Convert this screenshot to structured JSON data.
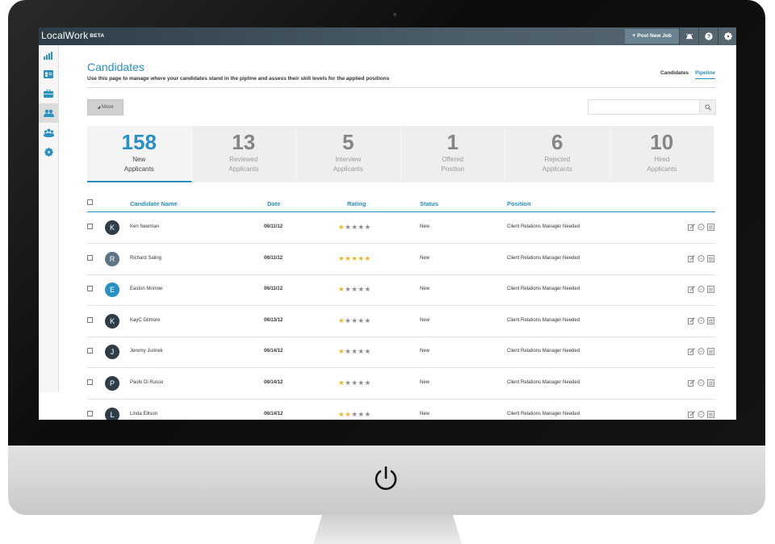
{
  "app": {
    "logo_text": "LocalWork",
    "logo_badge": "BETA"
  },
  "topbar": {
    "post_job_label": "Post New Job",
    "post_job_icon": "plus-icon",
    "icons": [
      "alarm-icon",
      "help-icon",
      "gear-icon"
    ]
  },
  "sidebar": {
    "items": [
      {
        "icon": "bar-chart-icon"
      },
      {
        "icon": "id-card-icon"
      },
      {
        "icon": "briefcase-icon"
      },
      {
        "icon": "users-icon",
        "active": true
      },
      {
        "icon": "team-icon"
      },
      {
        "icon": "gear-icon"
      }
    ]
  },
  "page": {
    "title": "Candidates",
    "subtitle": "Use this page to manage where your candidates stand in the pipline and assess their skill levels for the applied positions",
    "tabs": [
      {
        "label": "Candidates",
        "active": false
      },
      {
        "label": "Pipeline",
        "active": true
      }
    ]
  },
  "toolbar": {
    "move_label": "Move",
    "search_placeholder": ""
  },
  "stats": [
    {
      "count": "158",
      "line1": "New",
      "line2": "Applicants",
      "active": true
    },
    {
      "count": "13",
      "line1": "Reviewed",
      "line2": "Applicants"
    },
    {
      "count": "5",
      "line1": "Interview",
      "line2": "Applicants"
    },
    {
      "count": "1",
      "line1": "Offered",
      "line2": "Position"
    },
    {
      "count": "6",
      "line1": "Rejected",
      "line2": "Applicants"
    },
    {
      "count": "10",
      "line1": "Hired",
      "line2": "Applicants"
    }
  ],
  "table": {
    "columns": {
      "name": "Candidate Name",
      "date": "Date",
      "rating": "Rating",
      "status": "Status",
      "position": "Position"
    },
    "rows": [
      {
        "initial": "K",
        "avatar_color": "#2e3d48",
        "name": "Ken Newman",
        "date": "06/11/12",
        "rating": 1,
        "status": "New",
        "position": "Client Relations Manager Needed"
      },
      {
        "initial": "R",
        "avatar_color": "#5d7584",
        "name": "Richard Saling",
        "date": "06/11/12",
        "rating": 5,
        "status": "New",
        "position": "Client Relations Manager Needed"
      },
      {
        "initial": "E",
        "avatar_color": "#2a8fc1",
        "name": "Easton Morrow",
        "date": "06/11/12",
        "rating": 1,
        "status": "New",
        "position": "Client Relations Manager Needed"
      },
      {
        "initial": "K",
        "avatar_color": "#2e3d48",
        "name": "KayC Gilmore",
        "date": "06/13/12",
        "rating": 1,
        "status": "New",
        "position": "Client Relations Manager Needed"
      },
      {
        "initial": "J",
        "avatar_color": "#2e3d48",
        "name": "Jeremy Jurinek",
        "date": "06/14/12",
        "rating": 1,
        "status": "New",
        "position": "Client Relations Manager Needed"
      },
      {
        "initial": "P",
        "avatar_color": "#2e3d48",
        "name": "Paolo Di Russo",
        "date": "06/14/12",
        "rating": 1,
        "status": "New",
        "position": "Client Relations Manager Needed"
      },
      {
        "initial": "L",
        "avatar_color": "#2e3d48",
        "name": "Linda Ellison",
        "date": "06/14/12",
        "rating": 2,
        "status": "New",
        "position": "Client Relations Manager Needed"
      }
    ],
    "row_actions": [
      "edit-icon",
      "comment-icon",
      "notes-icon"
    ]
  },
  "colors": {
    "accent": "#2a8fc1",
    "topbar": "#3e4f5a",
    "star": "#f0b21c"
  },
  "device": {
    "power_icon": "power-icon"
  }
}
